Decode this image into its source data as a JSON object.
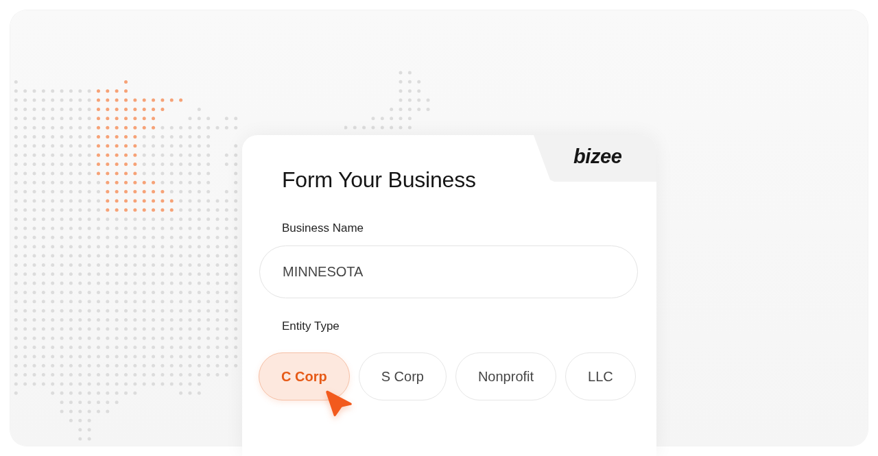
{
  "logo": "bizee",
  "form": {
    "title": "Form Your Business",
    "business_name": {
      "label": "Business Name",
      "value": "MINNESOTA"
    },
    "entity_type": {
      "label": "Entity Type",
      "options": [
        {
          "label": "C Corp",
          "selected": true
        },
        {
          "label": "S Corp",
          "selected": false
        },
        {
          "label": "Nonprofit",
          "selected": false
        },
        {
          "label": "LLC",
          "selected": false
        }
      ]
    }
  }
}
